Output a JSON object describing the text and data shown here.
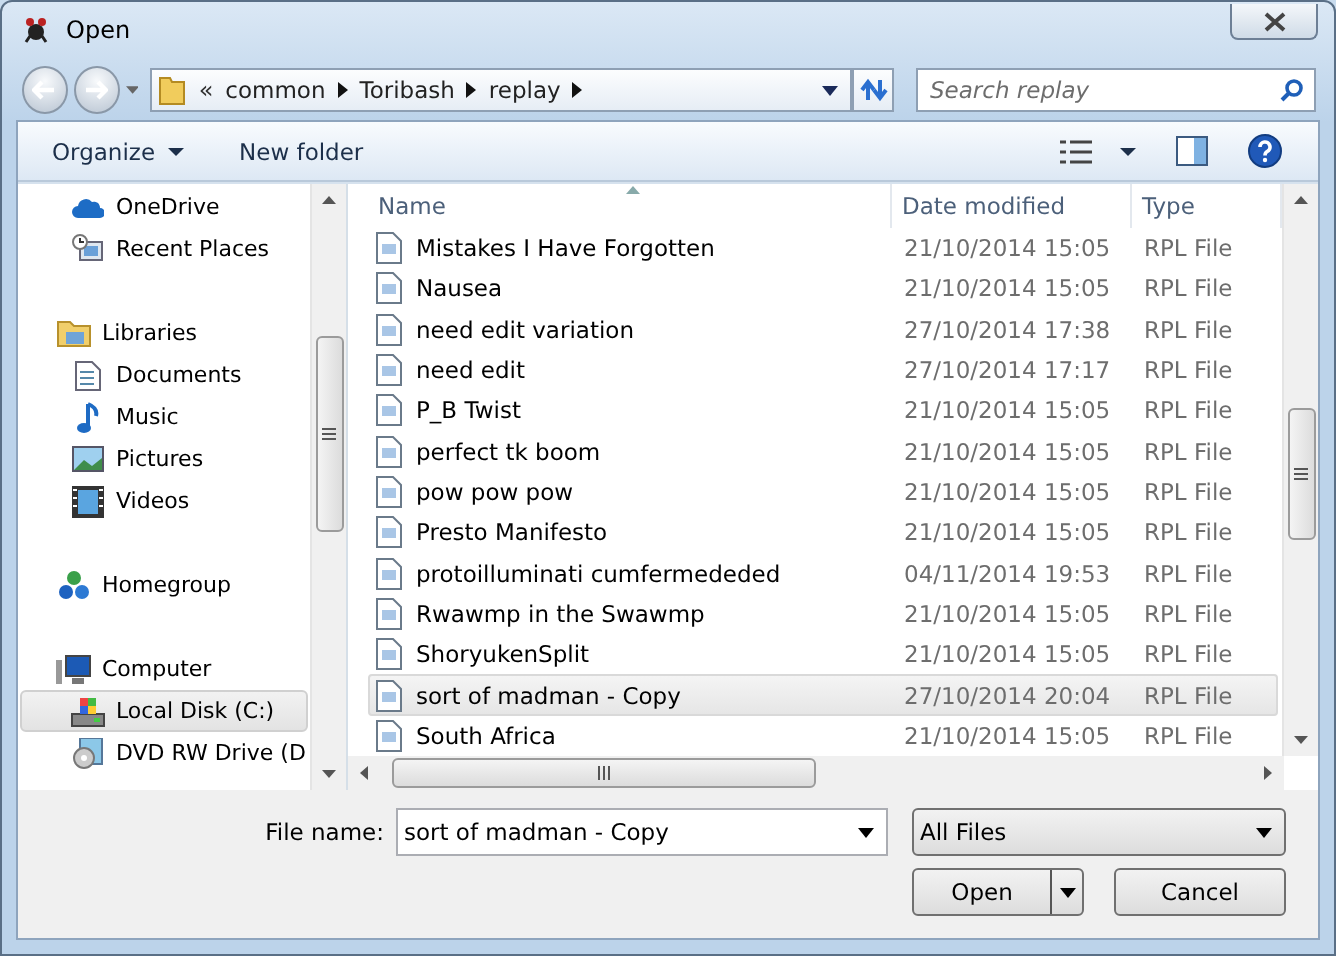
{
  "window": {
    "title": "Open"
  },
  "address": {
    "overflow": "«",
    "path": [
      "common",
      "Toribash",
      "replay"
    ]
  },
  "search": {
    "placeholder": "Search replay"
  },
  "toolbar": {
    "organize": "Organize",
    "new_folder": "New folder"
  },
  "nav": [
    {
      "children": [
        {
          "label": "OneDrive",
          "selected": false
        },
        {
          "label": "Recent Places",
          "selected": false
        }
      ]
    },
    {
      "label": "Libraries",
      "selected": false,
      "children": [
        {
          "label": "Documents",
          "selected": false
        },
        {
          "label": "Music",
          "selected": false
        },
        {
          "label": "Pictures",
          "selected": false
        },
        {
          "label": "Videos",
          "selected": false
        }
      ]
    },
    {
      "label": "Homegroup",
      "selected": false
    },
    {
      "label": "Computer",
      "selected": false,
      "children": [
        {
          "label": "Local Disk (C:)",
          "selected": true
        },
        {
          "label": "DVD RW Drive (D",
          "selected": false
        }
      ]
    }
  ],
  "table": {
    "columns": [
      "Name",
      "Date modified",
      "Type"
    ],
    "rows": [
      {
        "name": "Mistakes I Have Forgotten",
        "date": "21/10/2014 15:05",
        "type": "RPL File",
        "selected": false
      },
      {
        "name": "Nausea",
        "date": "21/10/2014 15:05",
        "type": "RPL File",
        "selected": false
      },
      {
        "name": "need edit variation",
        "date": "27/10/2014 17:38",
        "type": "RPL File",
        "selected": false
      },
      {
        "name": "need edit",
        "date": "27/10/2014 17:17",
        "type": "RPL File",
        "selected": false
      },
      {
        "name": "P_B Twist",
        "date": "21/10/2014 15:05",
        "type": "RPL File",
        "selected": false
      },
      {
        "name": "perfect tk boom",
        "date": "21/10/2014 15:05",
        "type": "RPL File",
        "selected": false
      },
      {
        "name": "pow pow pow",
        "date": "21/10/2014 15:05",
        "type": "RPL File",
        "selected": false
      },
      {
        "name": "Presto Manifesto",
        "date": "21/10/2014 15:05",
        "type": "RPL File",
        "selected": false
      },
      {
        "name": "protoilluminati cumfermededed",
        "date": "04/11/2014 19:53",
        "type": "RPL File",
        "selected": false
      },
      {
        "name": "Rwawmp in the Swawmp",
        "date": "21/10/2014 15:05",
        "type": "RPL File",
        "selected": false
      },
      {
        "name": "ShoryukenSplit",
        "date": "21/10/2014 15:05",
        "type": "RPL File",
        "selected": false
      },
      {
        "name": "sort of madman - Copy",
        "date": "27/10/2014 20:04",
        "type": "RPL File",
        "selected": true
      },
      {
        "name": "South Africa",
        "date": "21/10/2014 15:05",
        "type": "RPL File",
        "selected": false
      }
    ]
  },
  "footer": {
    "file_name_label": "File name:",
    "file_name": "sort of madman - Copy",
    "file_type": "All Files",
    "buttons": [
      "Open",
      "Cancel"
    ]
  }
}
